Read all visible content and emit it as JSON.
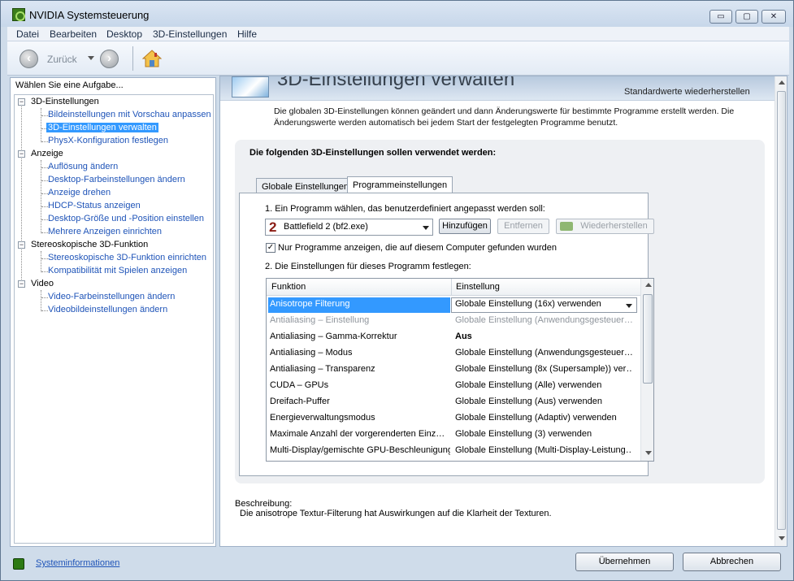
{
  "window": {
    "title": "NVIDIA Systemsteuerung",
    "buttons": {
      "minimize": "▭",
      "maximize": "▢",
      "close": "✕"
    }
  },
  "menu": [
    "Datei",
    "Bearbeiten",
    "Desktop",
    "3D-Einstellungen",
    "Hilfe"
  ],
  "toolbar": {
    "back_label": "Zurück"
  },
  "task_panel": {
    "header": "Wählen Sie eine Aufgabe...",
    "categories": [
      {
        "label": "3D-Einstellungen",
        "items": [
          "Bildeinstellungen mit Vorschau anpassen",
          "3D-Einstellungen verwalten",
          "PhysX-Konfiguration festlegen"
        ]
      },
      {
        "label": "Anzeige",
        "items": [
          "Auflösung ändern",
          "Desktop-Farbeinstellungen ändern",
          "Anzeige drehen",
          "HDCP-Status anzeigen",
          "Desktop-Größe und -Position einstellen",
          "Mehrere Anzeigen einrichten"
        ]
      },
      {
        "label": "Stereoskopische 3D-Funktion",
        "items": [
          "Stereoskopische 3D-Funktion einrichten",
          "Kompatibilität mit Spielen anzeigen"
        ]
      },
      {
        "label": "Video",
        "items": [
          "Video-Farbeinstellungen ändern",
          "Videobildeinstellungen ändern"
        ]
      }
    ],
    "selected": "3D-Einstellungen verwalten",
    "sysinfo": "Systeminformationen"
  },
  "main": {
    "title": "3D-Einstellungen verwalten",
    "restore_defaults": "Standardwerte wiederherstellen",
    "intro": "Die globalen 3D-Einstellungen können geändert und dann Änderungswerte für bestimmte Programme erstellt werden. Die Änderungswerte werden automatisch bei jedem Start der festgelegten Programme benutzt.",
    "heading": "Die folgenden 3D-Einstellungen sollen verwendet werden:",
    "tabs": [
      "Globale Einstellungen",
      "Programmeinstellungen"
    ],
    "active_tab": "Programmeinstellungen",
    "step1": "1. Ein Programm wählen, das benutzerdefiniert angepasst werden soll:",
    "program_icon": "2",
    "program": "Battlefield 2 (bf2.exe)",
    "buttons": {
      "add": "Hinzufügen",
      "remove": "Entfernen",
      "restore": "Wiederherstellen"
    },
    "checkbox": {
      "label": "Nur Programme anzeigen, die auf diesem Computer gefunden wurden",
      "checked": true,
      "mark": "✓"
    },
    "step2": "2. Die Einstellungen für dieses Programm festlegen:",
    "grid": {
      "columns": [
        "Funktion",
        "Einstellung"
      ],
      "rows": [
        {
          "func": "Anisotrope Filterung",
          "val": "Globale Einstellung (16x) verwenden",
          "state": "selected"
        },
        {
          "func": "Antialiasing – Einstellung",
          "val": "Globale Einstellung (Anwendungsgesteuer…",
          "state": "disabled"
        },
        {
          "func": "Antialiasing – Gamma-Korrektur",
          "val": "Aus",
          "state": "bold"
        },
        {
          "func": "Antialiasing – Modus",
          "val": "Globale Einstellung (Anwendungsgesteuer…",
          "state": ""
        },
        {
          "func": "Antialiasing – Transparenz",
          "val": "Globale Einstellung (8x (Supersample)) ver…",
          "state": ""
        },
        {
          "func": "CUDA – GPUs",
          "val": "Globale Einstellung (Alle) verwenden",
          "state": ""
        },
        {
          "func": "Dreifach-Puffer",
          "val": "Globale Einstellung (Aus) verwenden",
          "state": ""
        },
        {
          "func": "Energieverwaltungsmodus",
          "val": "Globale Einstellung (Adaptiv) verwenden",
          "state": ""
        },
        {
          "func": "Maximale Anzahl der vorgerenderten Einz…",
          "val": "Globale Einstellung (3) verwenden",
          "state": ""
        },
        {
          "func": "Multi-Display/gemischte GPU-Beschleunigung",
          "val": "Globale Einstellung (Multi-Display-Leistung…",
          "state": ""
        }
      ]
    },
    "description_label": "Beschreibung:",
    "description": "Die anisotrope Textur-Filterung hat Auswirkungen auf die Klarheit der Texturen."
  },
  "footer": {
    "ok": "Übernehmen",
    "cancel": "Abbrechen"
  }
}
